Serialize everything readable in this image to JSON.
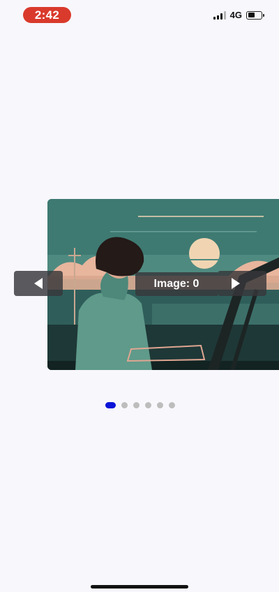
{
  "status_bar": {
    "time": "2:42",
    "network": "4G",
    "signal-icon": "signal-icon",
    "battery_level": 0.45
  },
  "carousel": {
    "caption": "Image: 0",
    "current_index": 0,
    "total_slides": 6,
    "prev_icon": "chevron-left-icon",
    "next_icon": "chevron-right-icon",
    "colors": {
      "active_dot": "#0a14d8",
      "inactive_dot": "#bdbdbd",
      "control_bg": "#37373a"
    }
  }
}
